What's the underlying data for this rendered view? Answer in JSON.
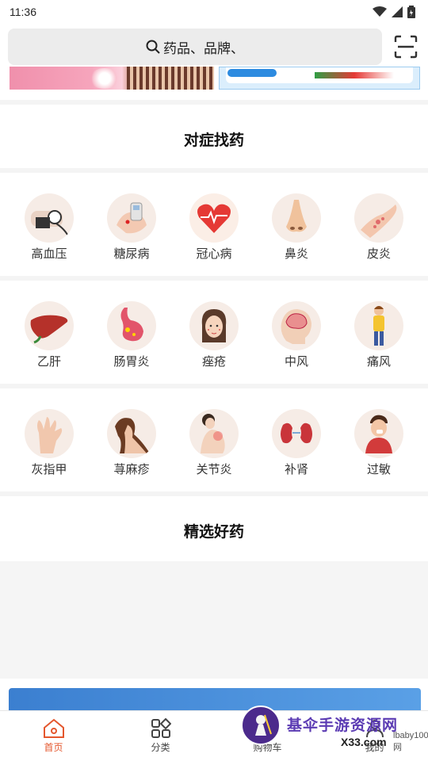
{
  "status_bar": {
    "time": "11:36"
  },
  "search": {
    "placeholder": "药品、品牌、"
  },
  "sections": {
    "symptoms_title": "对症找药",
    "featured_title": "精选好药"
  },
  "categories": [
    [
      {
        "label": "高血压",
        "icon": "blood-pressure-icon"
      },
      {
        "label": "糖尿病",
        "icon": "diabetes-icon"
      },
      {
        "label": "冠心病",
        "icon": "heart-icon"
      },
      {
        "label": "鼻炎",
        "icon": "nose-icon"
      },
      {
        "label": "皮炎",
        "icon": "skin-icon"
      }
    ],
    [
      {
        "label": "乙肝",
        "icon": "liver-icon"
      },
      {
        "label": "肠胃炎",
        "icon": "stomach-icon"
      },
      {
        "label": "痤疮",
        "icon": "acne-icon"
      },
      {
        "label": "中风",
        "icon": "brain-icon"
      },
      {
        "label": "痛风",
        "icon": "gout-icon"
      }
    ],
    [
      {
        "label": "灰指甲",
        "icon": "nail-icon"
      },
      {
        "label": "荨麻疹",
        "icon": "hives-icon"
      },
      {
        "label": "关节炎",
        "icon": "joint-icon"
      },
      {
        "label": "补肾",
        "icon": "kidney-icon"
      },
      {
        "label": "过敏",
        "icon": "allergy-icon"
      }
    ]
  ],
  "tabs": [
    {
      "label": "首页",
      "icon": "home-icon",
      "active": true
    },
    {
      "label": "分类",
      "icon": "grid-icon",
      "active": false
    },
    {
      "label": "购物车",
      "icon": "cart-icon",
      "active": false
    },
    {
      "label": "我的",
      "icon": "user-icon",
      "active": false
    }
  ],
  "watermark": {
    "title": "基伞手游资源网",
    "site": "X33.com",
    "sub": "lbaby100网"
  },
  "colors": {
    "accent": "#e4572e",
    "search_bg": "#ececec",
    "separator": "#f4f4f4"
  }
}
